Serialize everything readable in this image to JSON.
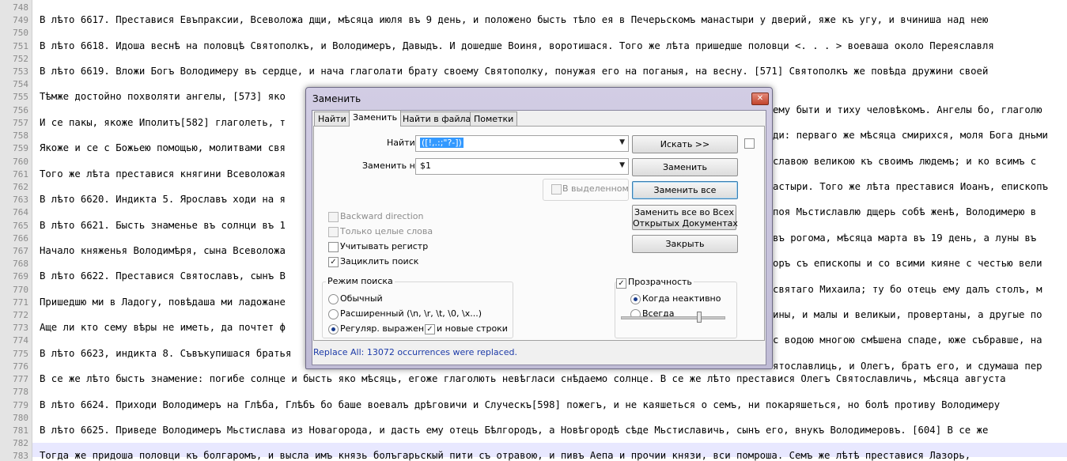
{
  "editor": {
    "lines": [
      {
        "num": "748",
        "text": ""
      },
      {
        "num": "749",
        "text": "В лѣто 6617. Преставися Евъпраксии, Всеволожа дщи, мѣсяца июля въ 9 день, и положено бысть тѣло ея в Печерьскомъ манастыри у дверий, яже къ угу, и вчиниша над нею"
      },
      {
        "num": "750",
        "text": ""
      },
      {
        "num": "751",
        "text": "В лѣто 6618. Идоша веснѣ на половцѣ Святополкъ, и Володимеръ, Давыдъ. И дошедше Воиня, воротишася. Того же лѣта пришедше половци <. . . > воеваша около Переяславля"
      },
      {
        "num": "752",
        "text": ""
      },
      {
        "num": "753",
        "text": "В лѣто 6619. Вложи Богъ Володимеру въ сердце, и нача глаголати брату своему Святополку, понужая его на поганыя, на весну. [571] Святополкъ же повѣда дружини своей"
      },
      {
        "num": "754",
        "text": ""
      },
      {
        "num": "755",
        "text": "Тѣмже достойно похволяти ангелы, [573] яко"
      },
      {
        "num": "756",
        "text": ""
      },
      {
        "num": "757",
        "text": "И се пакы, якоже Иполитъ[582] глаголеть, т"
      },
      {
        "num": "758",
        "text": ""
      },
      {
        "num": "759",
        "text": "Якоже и се с Божьею помощью, молитвами свя"
      },
      {
        "num": "760",
        "text": ""
      },
      {
        "num": "761",
        "text": "Того же лѣта преставися княгини Всеволожая"
      },
      {
        "num": "762",
        "text": ""
      },
      {
        "num": "763",
        "text": "В лѣто 6620. Индикта 5. Ярославъ ходи на я"
      },
      {
        "num": "764",
        "text": ""
      },
      {
        "num": "765",
        "text": "В лѣто 6621. Бысть знаменье въ солнци въ 1"
      },
      {
        "num": "766",
        "text": ""
      },
      {
        "num": "767",
        "text": "Начало княженья Володимѣря, сына Всеволожа"
      },
      {
        "num": "768",
        "text": ""
      },
      {
        "num": "769",
        "text": "В лѣто 6622. Преставися Святославъ, сынъ В"
      },
      {
        "num": "770",
        "text": ""
      },
      {
        "num": "771",
        "text": "Пришедшю ми в Ладогу, повѣдаша ми ладожане"
      },
      {
        "num": "772",
        "text": ""
      },
      {
        "num": "773",
        "text": "Аще ли кто сему вѣры не иметь, да почтет ф"
      },
      {
        "num": "774",
        "text": ""
      },
      {
        "num": "775",
        "text": "В лѣто 6623, индикта 8. Съвъкупишася братья"
      },
      {
        "num": "776",
        "text": ""
      },
      {
        "num": "777",
        "text": "В се же лѣто бысть знамение: погибе солнце и бысть яко мѣсяць, егоже глаголють невѣгласи снѣдаемо солнце. В се же лѣто преставися Олегъ Святославличь, мѣсяца августа"
      },
      {
        "num": "778",
        "text": ""
      },
      {
        "num": "779",
        "text": "В лѣто 6624. Приходи Володимеръ на Глѣба, Глѣбъ бо баше воевалъ дрѣговичи и Случескъ[598] пожегъ, и не каяшеться о семъ, ни покаряшеться, но болѣ противу Володимеру"
      },
      {
        "num": "780",
        "text": ""
      },
      {
        "num": "781",
        "text": "В лѣто 6625. Приведе Володимеръ Мьстислава из Новагорода, и дасть ему отець Бѣлгородъ, а Новѣгородѣ сѣде Мьстиславичь, сынъ его, внукъ Володимеровъ. [604] В се же"
      },
      {
        "num": "782",
        "text": ""
      },
      {
        "num": "783",
        "text": "Тогда же придоша половци къ болгаромъ, и высла имъ князь болъгарьскый пити съ отравою, и пивъ Аепа и прочии князи, вси помроша. Семъ же лѣтѣ преставися Лазорь,"
      }
    ],
    "right_fragments": [
      {
        "row": 8,
        "text": "ему быти и тиху человѣкомъ. Ангелы бо, глаголю"
      },
      {
        "row": 10,
        "text": "ди: перваго же мѣсяца смирихся, моля Бога дньми"
      },
      {
        "row": 12,
        "text": "славою великою къ своимъ людемъ; и ко всимъ с"
      },
      {
        "row": 14,
        "text": "астыри. Того же лѣта преставися Иоанъ, епископъ"
      },
      {
        "row": 16,
        "text": "поя Мьстиславлю дщерь собѣ женѣ, Володимерю в"
      },
      {
        "row": 18,
        "text": "въ рогома, мѣсяца марта въ 19 день, а луны въ"
      },
      {
        "row": 20,
        "text": "оръ съ епископы и со всими кияне с честью вели"
      },
      {
        "row": 22,
        "text": "святаго Михаила; ту бо отець ему далъ столъ, м"
      },
      {
        "row": 24,
        "text": "ины, и малы и великыи, провертаны, а другые по"
      },
      {
        "row": 26,
        "text": "с водою многою смѣшена спаде, юже събравше, на"
      },
      {
        "row": 28,
        "text": "ятославлиць, и Олегъ, братъ его, и сдумаша пер"
      }
    ]
  },
  "dialog": {
    "title": "Заменить",
    "close": "✕",
    "tabs": [
      "Найти",
      "Заменить",
      "Найти в файлах",
      "Пометки"
    ],
    "find_label": "Найти:",
    "find_value": "([!,.:;\"?-])",
    "replace_label": "Заменить на:",
    "replace_value": "$1",
    "in_selection": "В выделенном",
    "buttons": {
      "find_next": "Искать >>",
      "replace": "Заменить",
      "replace_all": "Заменить все",
      "replace_all_docs_1": "Заменить все во Всех",
      "replace_all_docs_2": "Открытых Документах",
      "close": "Закрыть"
    },
    "options": {
      "backward": "Backward direction",
      "whole_word": "Только целые слова",
      "match_case": "Учитывать регистр",
      "wrap": "Зациклить поиск"
    },
    "search_mode": {
      "title": "Режим поиска",
      "normal": "Обычный",
      "extended": "Расширенный (\\n, \\r, \\t, \\0, \\x...)",
      "regex": "Регуляр. выражен.",
      "newline": "и новые строки"
    },
    "transparency": {
      "title": "Прозрачность",
      "on_lose_focus": "Когда неактивно",
      "always": "Всегда",
      "level": 0.75
    },
    "status": "Replace All: 13072 occurrences were replaced."
  }
}
